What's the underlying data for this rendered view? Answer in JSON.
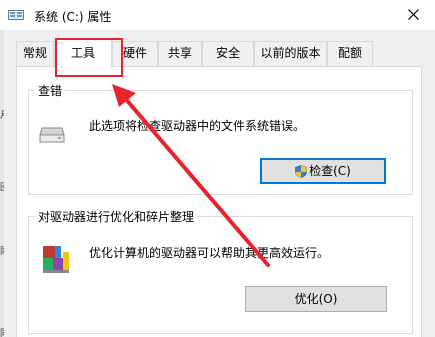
{
  "window": {
    "title": "系统 (C:) 属性",
    "icon": "drive-icon",
    "close_icon": "close-icon"
  },
  "tabs": [
    {
      "label": "常规",
      "active": false
    },
    {
      "label": "工具",
      "active": true
    },
    {
      "label": "硬件",
      "active": false
    },
    {
      "label": "共享",
      "active": false
    },
    {
      "label": "安全",
      "active": false
    },
    {
      "label": "以前的版本",
      "active": false
    },
    {
      "label": "配额",
      "active": false
    }
  ],
  "check_group": {
    "title": "查错",
    "description": "此选项将检查驱动器中的文件系统错误。",
    "icon": "disk-drive-icon",
    "button_label": "检查(C)",
    "button_icon": "uac-shield-icon"
  },
  "optimize_group": {
    "title": "对驱动器进行优化和碎片整理",
    "description": "优化计算机的驱动器可以帮助其更高效运行。",
    "icon": "defrag-icon",
    "button_label": "优化(O)"
  },
  "annotation": {
    "highlight_color": "#e8232c"
  }
}
